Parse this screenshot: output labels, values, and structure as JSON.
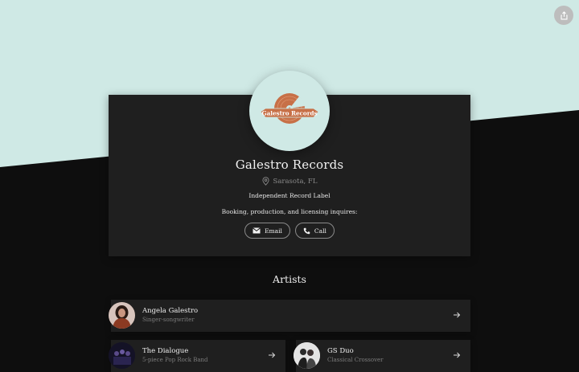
{
  "profile": {
    "name": "Galestro Records",
    "location": "Sarasota, FL",
    "tagline": "Independent Record Label",
    "bio": "Booking, production, and licensing inquires:",
    "logo_text": "Galestro Records"
  },
  "actions": {
    "email_label": "Email",
    "call_label": "Call"
  },
  "artists_section": {
    "title": "Artists",
    "items": [
      {
        "name": "Angela Galestro",
        "description": "Singer-songwriter"
      },
      {
        "name": "The Dialogue",
        "description": "5-piece Pop Rock Band"
      },
      {
        "name": "GS Duo",
        "description": "Classical Crossover"
      }
    ]
  },
  "colors": {
    "background_top": "#cfe9e5",
    "background_bottom": "#0e0e0e",
    "card": "#1f1f1f",
    "logo_brand": "#c77047"
  },
  "icons": {
    "share": "share-icon",
    "location": "map-pin-icon",
    "email": "mail-icon",
    "call": "phone-icon",
    "arrow": "arrow-right-icon"
  }
}
